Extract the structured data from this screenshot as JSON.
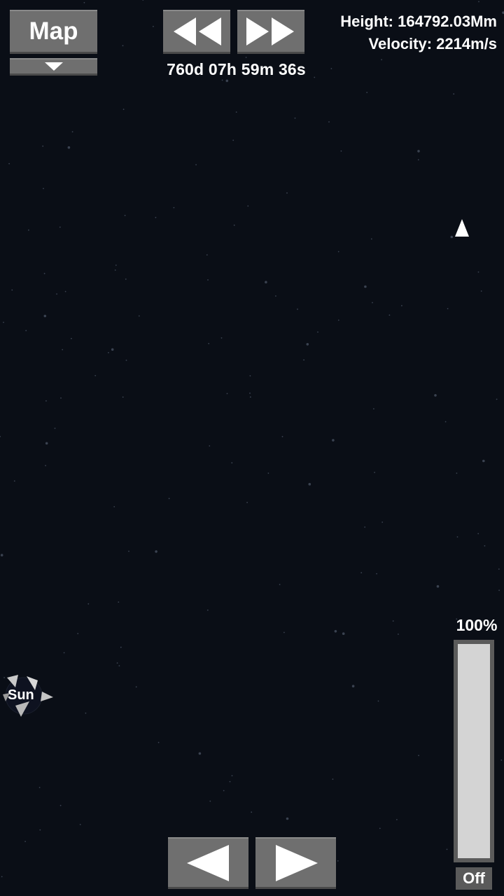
{
  "header": {
    "map_label": "Map",
    "time": "760d 07h 59m 36s",
    "height": "Height: 164792.03Mm",
    "velocity": "Velocity: 2214m/s"
  },
  "map_view": {
    "body_label": "Sun"
  },
  "throttle": {
    "percent_label": "100%",
    "level": 1.0,
    "engine_label": "Off"
  },
  "icons": {
    "dropdown": "chevron-down-icon",
    "rewind": "rewind-icon",
    "fast_forward": "fast-forward-icon",
    "rotate_left": "arrow-left-icon",
    "rotate_right": "arrow-right-icon",
    "rocket": "rocket-marker-icon",
    "sun": "sun-marker-icon"
  },
  "colors": {
    "background": "#0a0e16",
    "button": "#6f6f6f",
    "throttle_fill": "#d4d4d4"
  }
}
